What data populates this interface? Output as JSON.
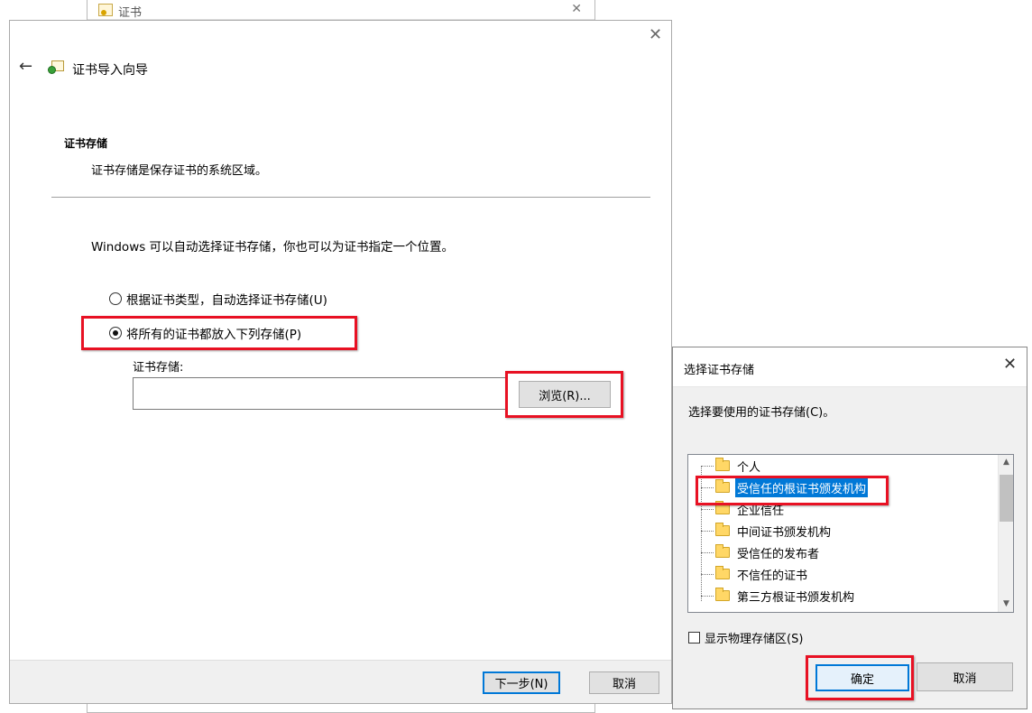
{
  "background_window": {
    "title": "证书",
    "close_glyph": "✕"
  },
  "wizard": {
    "back_glyph": "←",
    "title": "证书导入向导",
    "close_glyph": "✕",
    "section_heading": "证书存储",
    "section_desc": "证书存储是保存证书的系统区域。",
    "intro_text": "Windows 可以自动选择证书存储，你也可以为证书指定一个位置。",
    "radio_auto": {
      "label": "根据证书类型，自动选择证书存储(U)",
      "checked": false
    },
    "radio_manual": {
      "label": "将所有的证书都放入下列存储(P)",
      "checked": true
    },
    "store_label": "证书存储:",
    "store_value": "",
    "browse_label": "浏览(R)...",
    "next_label": "下一步(N)",
    "cancel_label": "取消"
  },
  "dialog": {
    "title": "选择证书存储",
    "close_glyph": "✕",
    "prompt": "选择要使用的证书存储(C)。",
    "tree_items": [
      {
        "label": "个人",
        "selected": false
      },
      {
        "label": "受信任的根证书颁发机构",
        "selected": true
      },
      {
        "label": "企业信任",
        "selected": false
      },
      {
        "label": "中间证书颁发机构",
        "selected": false
      },
      {
        "label": "受信任的发布者",
        "selected": false
      },
      {
        "label": "不信任的证书",
        "selected": false
      },
      {
        "label": "第三方根证书颁发机构",
        "selected": false
      }
    ],
    "scroll_up_glyph": "▲",
    "scroll_down_glyph": "▼",
    "show_physical_label": "显示物理存储区(S)",
    "show_physical_checked": false,
    "ok_label": "确定",
    "cancel_label": "取消"
  },
  "colors": {
    "highlight": "#e81123",
    "selection": "#0078d7",
    "folder": "#ffd766"
  }
}
